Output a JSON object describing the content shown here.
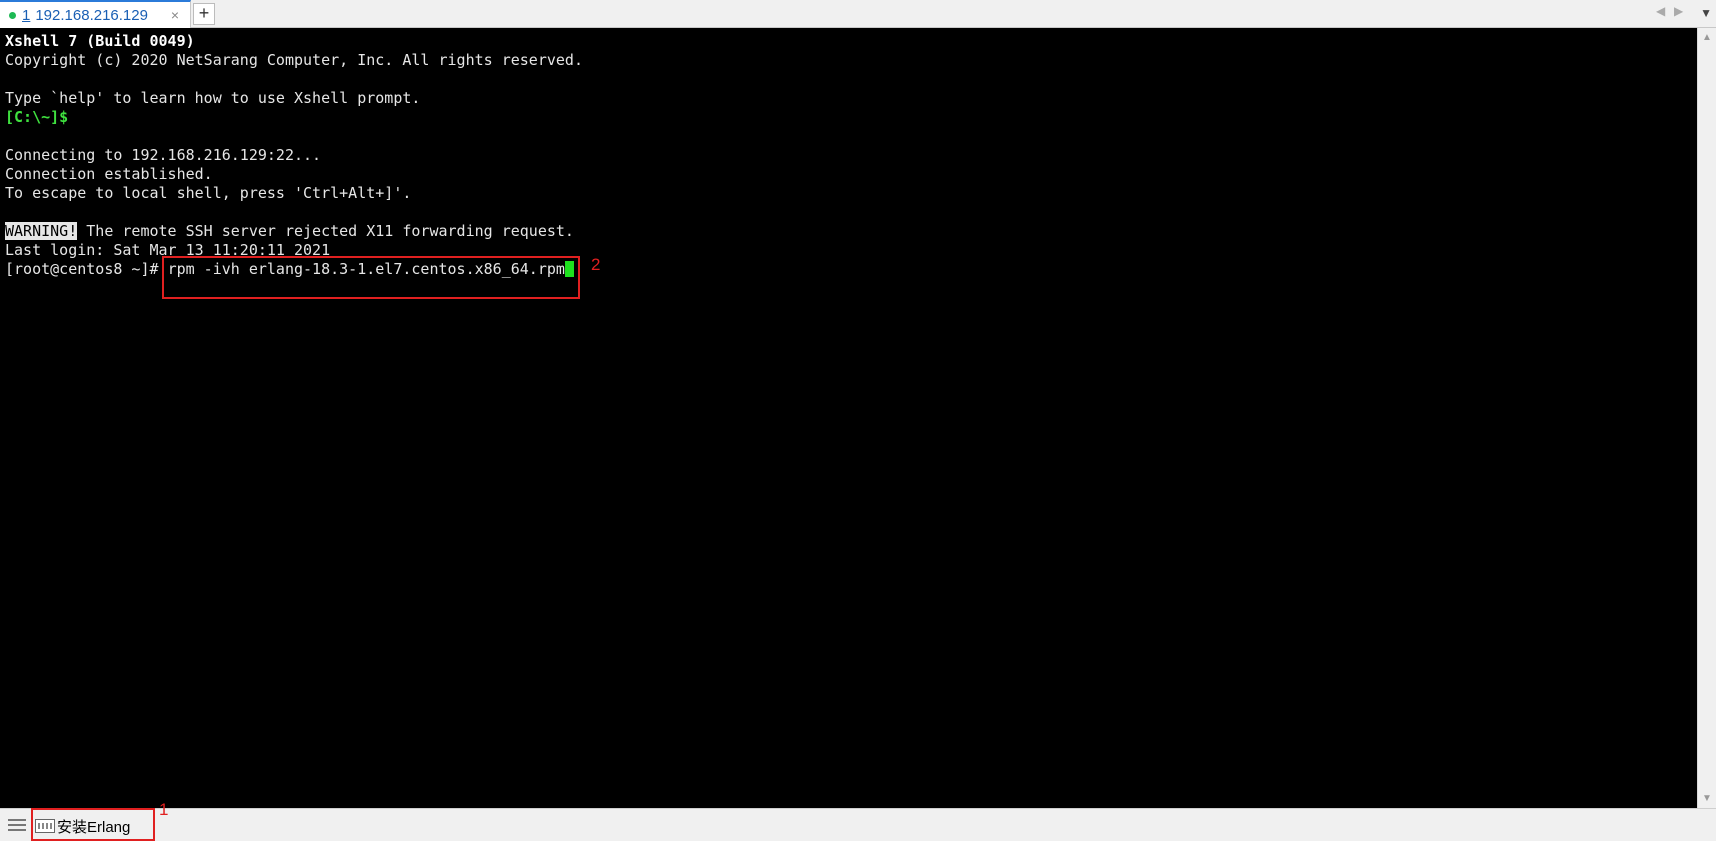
{
  "tab": {
    "number": "1",
    "title": "192.168.216.129",
    "close_glyph": "×",
    "new_tab_glyph": "+"
  },
  "tab_nav": {
    "left": "◀",
    "right": "▶",
    "menu": "▼"
  },
  "terminal": {
    "line1": "Xshell 7 (Build 0049)",
    "line2": "Copyright (c) 2020 NetSarang Computer, Inc. All rights reserved.",
    "line3": "Type `help' to learn how to use Xshell prompt.",
    "prompt_local": "[C:\\~]$",
    "line5": "Connecting to 192.168.216.129:22...",
    "line6": "Connection established.",
    "line7": "To escape to local shell, press 'Ctrl+Alt+]'.",
    "warning_label": "WARNING!",
    "warning_text": " The remote SSH server rejected X11 forwarding request.",
    "last_login": "Last login: Sat Mar 13 11:20:11 2021",
    "prompt_remote": "[root@centos8 ~]# ",
    "command": "rpm -ivh erlang-18.3-1.el7.centos.x86_64.rpm"
  },
  "quick_command": {
    "label": "安装Erlang"
  },
  "annotations": {
    "one": "1",
    "two": "2"
  },
  "colors": {
    "prompt_green": "#3fe03f",
    "cursor": "#1ee11e",
    "annotation_red": "#e02020",
    "tab_accent": "#2b7bd9"
  }
}
